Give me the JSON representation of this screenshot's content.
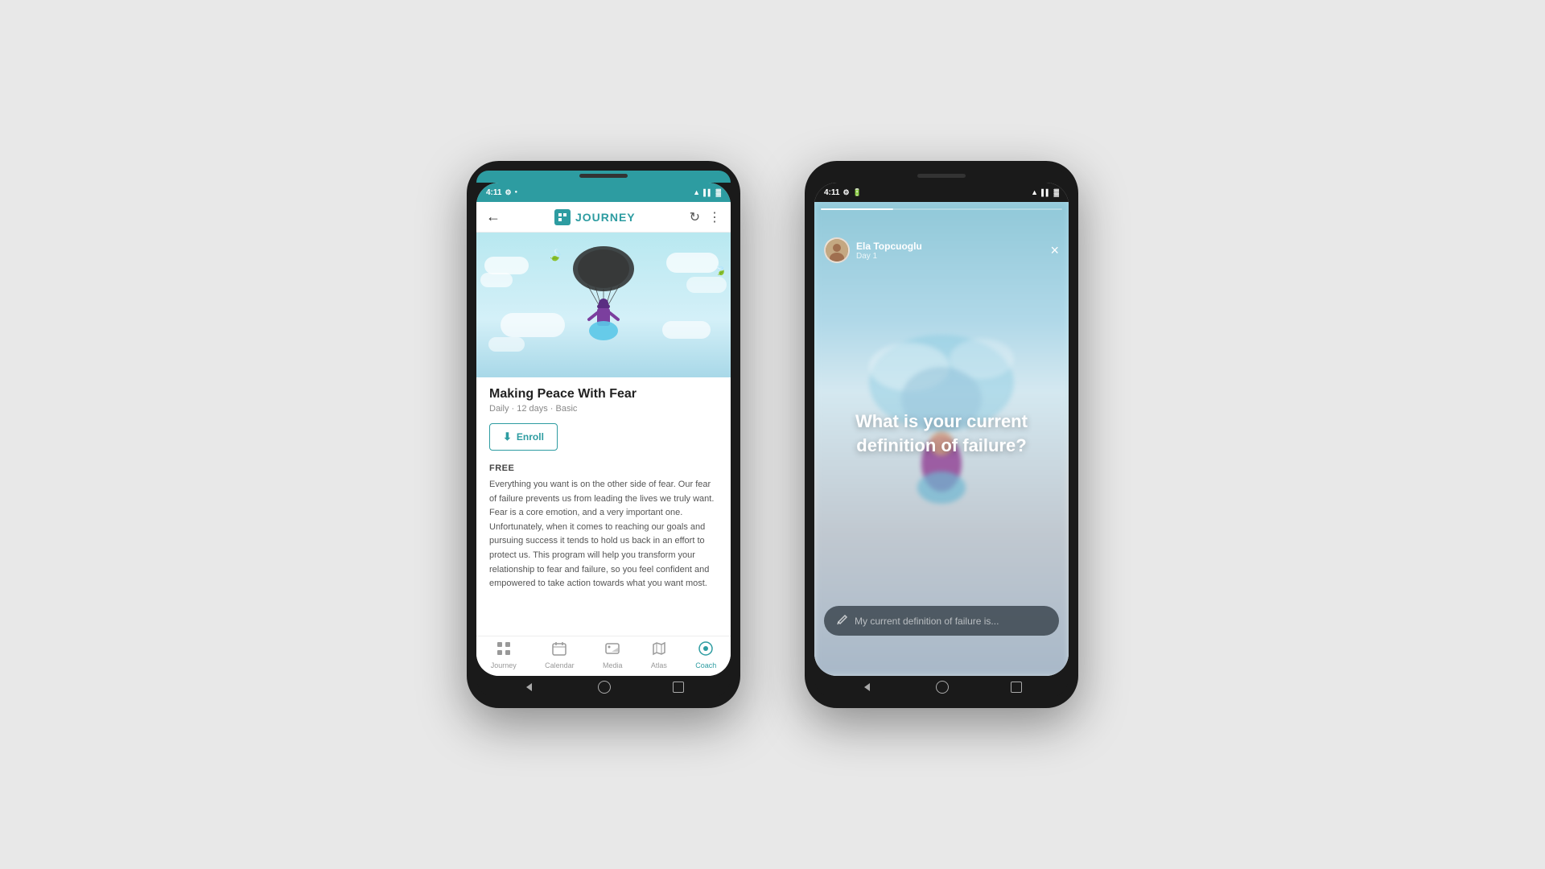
{
  "background": "#e8e8e8",
  "phone1": {
    "statusBar": {
      "time": "4:11",
      "background": "#2d9ca1"
    },
    "topbar": {
      "backLabel": "←",
      "title": "JOURNEY",
      "refreshIcon": "↻",
      "menuIcon": "⋮"
    },
    "hero": {
      "altText": "Parachuting person illustration with clouds"
    },
    "course": {
      "title": "Making Peace With Fear",
      "meta": "Daily · 12 days · Basic",
      "enrollLabel": "Enroll",
      "freeLabel": "FREE",
      "description": "Everything you want is on the other side of fear. Our fear of failure prevents us from leading the lives we truly want. Fear is a core emotion, and a very important one. Unfortunately, when it comes to reaching our goals and pursuing success it tends to hold us back in an effort to protect us. This program will help you transform your relationship to fear and failure, so you feel confident and empowered to take action towards what you want most."
    },
    "bottomNav": {
      "items": [
        {
          "label": "Journey",
          "icon": "⊞",
          "active": false
        },
        {
          "label": "Calendar",
          "icon": "📅",
          "active": false
        },
        {
          "label": "Media",
          "icon": "🖼",
          "active": false
        },
        {
          "label": "Atlas",
          "icon": "📖",
          "active": false
        },
        {
          "label": "Coach",
          "icon": "◎",
          "active": true
        }
      ]
    },
    "androidNav": {
      "back": "◁",
      "home": "○",
      "recent": "□"
    }
  },
  "phone2": {
    "statusBar": {
      "time": "4:11",
      "background": "#1a1a1a"
    },
    "story": {
      "progressPercent": 30,
      "userName": "Ela Topcuoglu",
      "dayLabel": "Day 1",
      "closeIcon": "×",
      "questionText": "What is your current definition of failure?",
      "inputPlaceholder": "My current definition of failure is..."
    },
    "androidNav": {
      "back": "◁",
      "home": "○",
      "recent": "□"
    }
  }
}
